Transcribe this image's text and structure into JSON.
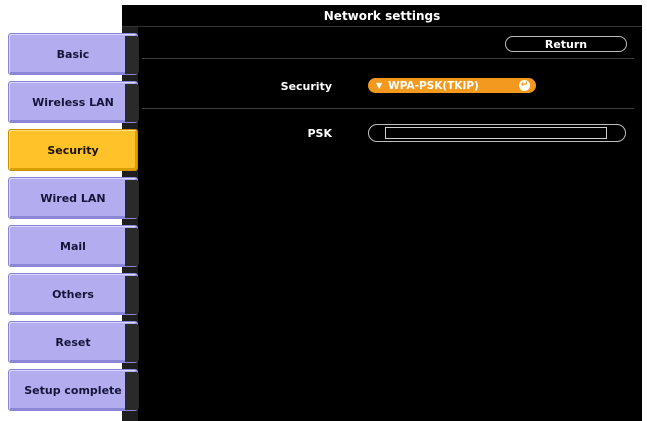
{
  "window": {
    "title": "Network settings"
  },
  "toolbar": {
    "return_label": "Return"
  },
  "sidebar": {
    "items": [
      {
        "label": "Basic"
      },
      {
        "label": "Wireless LAN"
      },
      {
        "label": "Security",
        "selected": true
      },
      {
        "label": "Wired LAN"
      },
      {
        "label": "Mail"
      },
      {
        "label": "Others"
      },
      {
        "label": "Reset"
      },
      {
        "label": "Setup complete"
      }
    ]
  },
  "form": {
    "security": {
      "label": "Security",
      "value": "WPA-PSK(TKIP)"
    },
    "psk": {
      "label": "PSK",
      "value": ""
    }
  },
  "colors": {
    "sidebar_button": "#b3adf0",
    "sidebar_selected": "#ffc229",
    "select_accent": "#f39a1e",
    "background": "#000000"
  }
}
